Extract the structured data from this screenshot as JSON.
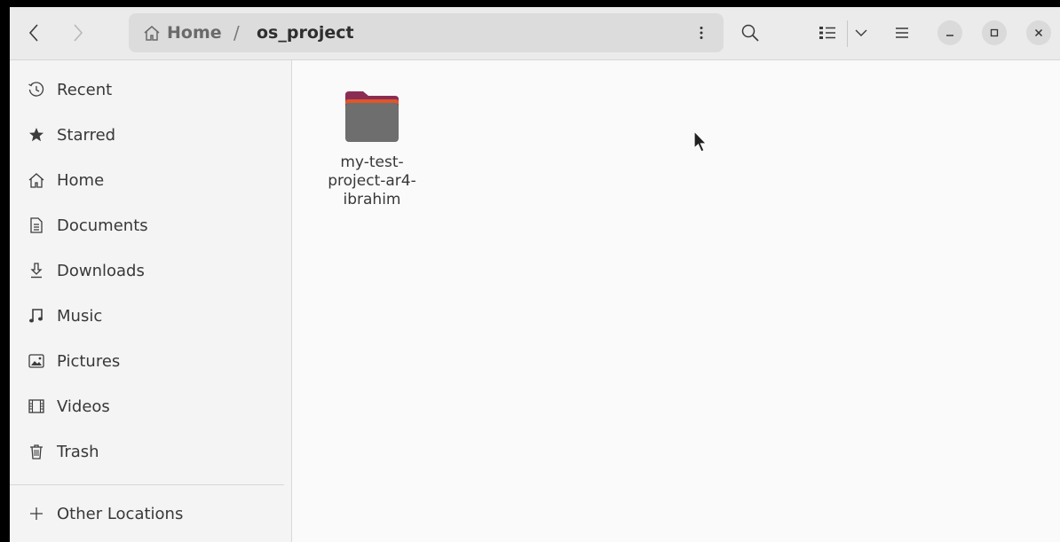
{
  "window": {
    "path": {
      "home_label": "Home",
      "separator": "/",
      "current": "os_project"
    }
  },
  "sidebar": {
    "items": [
      {
        "label": "Recent",
        "icon": "clock-icon"
      },
      {
        "label": "Starred",
        "icon": "star-icon"
      },
      {
        "label": "Home",
        "icon": "home-icon"
      },
      {
        "label": "Documents",
        "icon": "document-icon"
      },
      {
        "label": "Downloads",
        "icon": "download-icon"
      },
      {
        "label": "Music",
        "icon": "music-icon"
      },
      {
        "label": "Pictures",
        "icon": "picture-icon"
      },
      {
        "label": "Videos",
        "icon": "video-icon"
      },
      {
        "label": "Trash",
        "icon": "trash-icon"
      }
    ],
    "other_locations": {
      "label": "Other Locations",
      "icon": "plus-icon"
    }
  },
  "content": {
    "files": [
      {
        "name_lines": [
          "my-test-",
          "project-ar4-",
          "ibrahim"
        ],
        "icon": "folder-icon"
      }
    ]
  },
  "colors": {
    "folder_body": "#6e6e6e",
    "folder_tab": "#8a2d55",
    "folder_edge": "#e0562a"
  }
}
